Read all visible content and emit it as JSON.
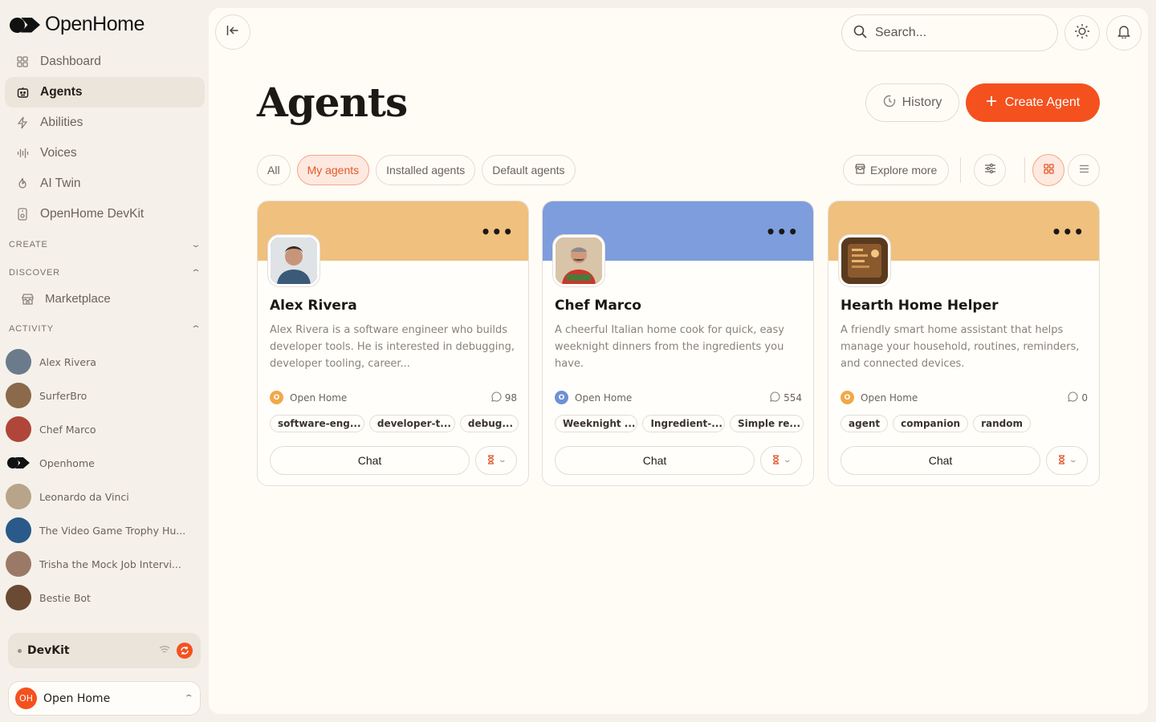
{
  "app": {
    "name": "OpenHome"
  },
  "nav": [
    {
      "label": "Dashboard",
      "icon": "grid-icon"
    },
    {
      "label": "Agents",
      "icon": "robot-icon",
      "active": true
    },
    {
      "label": "Abilities",
      "icon": "bolt-icon"
    },
    {
      "label": "Voices",
      "icon": "waveform-icon"
    },
    {
      "label": "AI Twin",
      "icon": "flame-icon"
    },
    {
      "label": "OpenHome DevKit",
      "icon": "device-icon"
    }
  ],
  "sections": {
    "create": "CREATE",
    "discover": "DISCOVER",
    "activity": "ACTIVITY",
    "marketplace": "Marketplace"
  },
  "activity": [
    {
      "name": "Alex Rivera",
      "color": "#6b7b8c"
    },
    {
      "name": "SurferBro",
      "color": "#8a6a4a"
    },
    {
      "name": "Chef Marco",
      "color": "#b0463a"
    },
    {
      "name": "Openhome",
      "color": "#111111"
    },
    {
      "name": "Leonardo da Vinci",
      "color": "#b8a488"
    },
    {
      "name": "The Video Game Trophy Hu...",
      "color": "#2a5a8a"
    },
    {
      "name": "Trisha the Mock Job Intervi...",
      "color": "#9a7a66"
    },
    {
      "name": "Bestie Bot",
      "color": "#6a4a32"
    }
  ],
  "devkit": {
    "label": "DevKit"
  },
  "account": {
    "initials": "OH",
    "name": "Open Home"
  },
  "header": {
    "search_placeholder": "Search...",
    "title": "Agents",
    "history_label": "History",
    "create_label": "Create Agent"
  },
  "filters": [
    {
      "label": "All"
    },
    {
      "label": "My agents",
      "active": true
    },
    {
      "label": "Installed agents"
    },
    {
      "label": "Default agents"
    }
  ],
  "explore_label": "Explore more",
  "cards": [
    {
      "name": "Alex Rivera",
      "banner": "#efc07e",
      "avatar_color": "#5f7186",
      "description": "Alex Rivera is a software engineer who builds developer tools. He is interested in debugging, developer tooling, career...",
      "owner": "Open Home",
      "owner_color": "#f0a94a",
      "count": "98",
      "tags": [
        "software-eng...",
        "developer-t...",
        "debug..."
      ],
      "chat_label": "Chat"
    },
    {
      "name": "Chef Marco",
      "banner": "#7d9ddd",
      "avatar_color": "#c0483a",
      "description": "A cheerful Italian home cook for quick, easy weeknight dinners from the ingredients you have.",
      "owner": "Open Home",
      "owner_color": "#6f8fd6",
      "count": "554",
      "tags": [
        "Weeknight ...",
        "Ingredient-...",
        "Simple re..."
      ],
      "chat_label": "Chat"
    },
    {
      "name": "Hearth Home Helper",
      "banner": "#efc07e",
      "avatar_color": "#8a5a2e",
      "description": "A friendly smart home assistant that helps manage your household, routines, reminders, and connected devices.",
      "owner": "Open Home",
      "owner_color": "#f0a94a",
      "count": "0",
      "tags": [
        "agent",
        "companion",
        "random"
      ],
      "chat_label": "Chat"
    }
  ]
}
